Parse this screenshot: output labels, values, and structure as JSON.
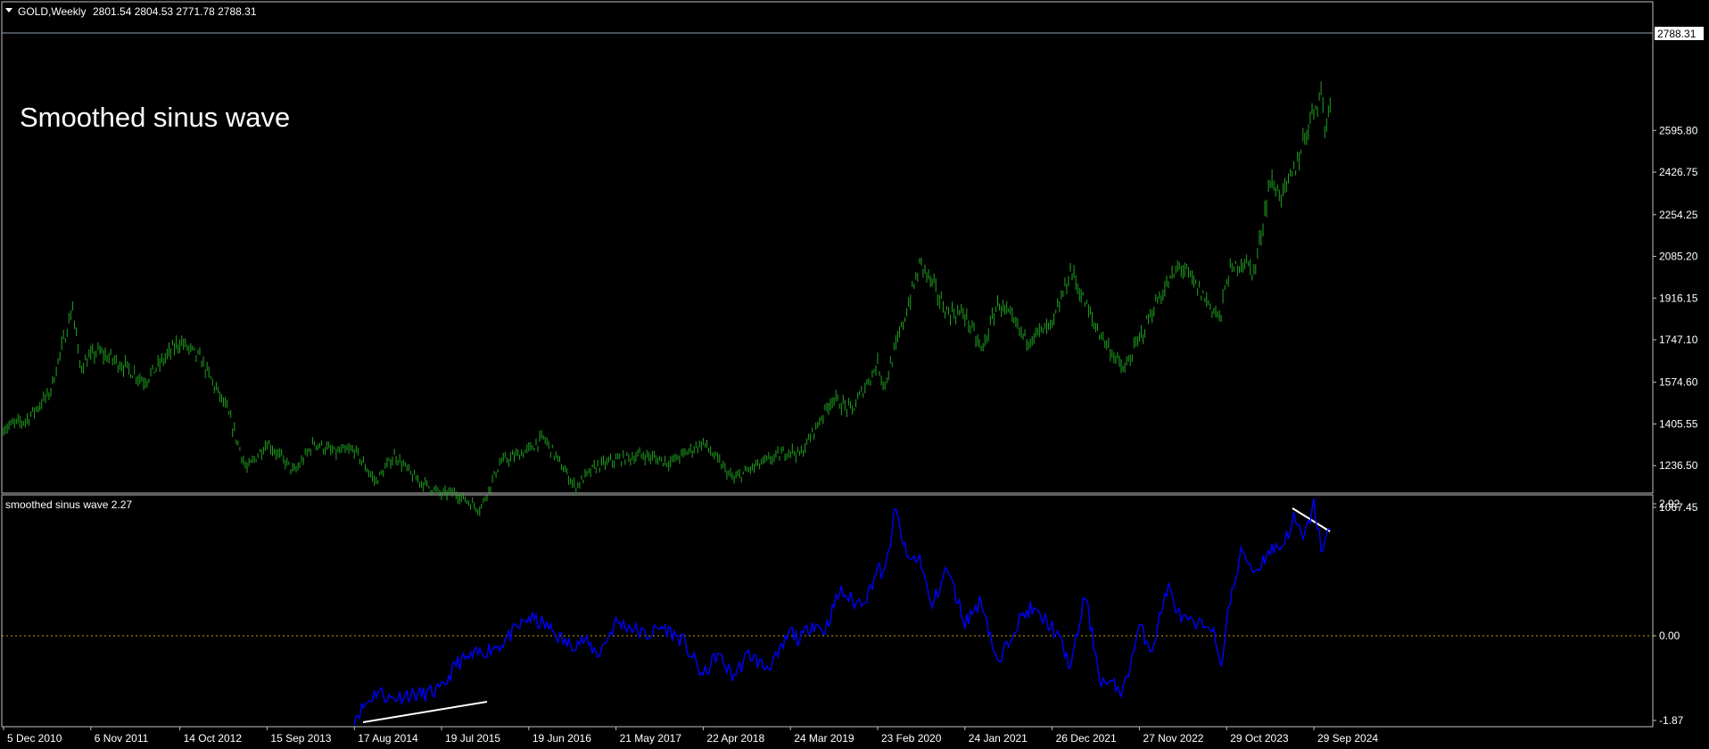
{
  "header": {
    "symbol": "GOLD,Weekly",
    "ohlc": "2801.54 2804.53 2771.78 2788.31",
    "dropdown_icon": "triangle-down-icon"
  },
  "main": {
    "overlay_label": "Smoothed sinus wave",
    "price_marker": "2788.31"
  },
  "indicator": {
    "label": "smoothed sinus wave 2.27"
  },
  "colors": {
    "background": "#000000",
    "candles": "#1fa31f",
    "indicator_line": "#0000ff",
    "trend_lines": "#ffffff",
    "zero_line": "#c8a000",
    "pane_border": "#c0c0c0",
    "current_price_line": "#8fa0b0"
  },
  "chart_data": [
    {
      "type": "bar",
      "title": "GOLD,Weekly",
      "y_ticks": [
        "2595.80",
        "2426.75",
        "2254.25",
        "2085.20",
        "1916.15",
        "1747.10",
        "1574.60",
        "1405.55",
        "1236.50",
        "1067.45"
      ],
      "ylim": [
        1000,
        2800
      ],
      "current_value": 2788.31,
      "x_ticks": [
        "5 Dec 2010",
        "6 Nov 2011",
        "14 Oct 2012",
        "15 Sep 2013",
        "17 Aug 2014",
        "19 Jul 2015",
        "19 Jun 2016",
        "21 May 2017",
        "22 Apr 2018",
        "24 Mar 2019",
        "23 Feb 2020",
        "24 Jan 2021",
        "26 Dec 2021",
        "27 Nov 2022",
        "29 Oct 2023",
        "29 Sep 2024"
      ],
      "series": [
        {
          "name": "GOLD,Weekly",
          "x": [
            "2010-12-05",
            "2011-03-01",
            "2011-06-01",
            "2011-08-28",
            "2011-09-25",
            "2011-12-01",
            "2012-03-01",
            "2012-06-01",
            "2012-10-14",
            "2013-01-01",
            "2013-04-15",
            "2013-06-28",
            "2013-09-15",
            "2013-12-31",
            "2014-03-15",
            "2014-06-01",
            "2014-08-17",
            "2014-11-07",
            "2015-01-20",
            "2015-04-01",
            "2015-07-19",
            "2015-09-01",
            "2015-12-15",
            "2016-03-01",
            "2016-06-19",
            "2016-08-15",
            "2016-12-15",
            "2017-03-01",
            "2017-05-21",
            "2017-09-01",
            "2017-12-15",
            "2018-04-22",
            "2018-08-16",
            "2018-11-01",
            "2019-03-24",
            "2019-05-01",
            "2019-09-01",
            "2019-11-15",
            "2020-02-23",
            "2020-03-20",
            "2020-08-07",
            "2020-11-15",
            "2021-01-24",
            "2021-03-30",
            "2021-06-01",
            "2021-09-15",
            "2021-12-26",
            "2022-03-08",
            "2022-06-01",
            "2022-09-28",
            "2022-11-27",
            "2023-02-01",
            "2023-05-04",
            "2023-10-06",
            "2023-10-29",
            "2023-12-28",
            "2024-02-14",
            "2024-04-12",
            "2024-06-01",
            "2024-07-15",
            "2024-09-29",
            "2024-10-30",
            "2024-11-14",
            "2024-12-06"
          ],
          "values": [
            1390,
            1420,
            1530,
            1880,
            1640,
            1700,
            1650,
            1580,
            1740,
            1670,
            1460,
            1220,
            1330,
            1210,
            1330,
            1290,
            1300,
            1170,
            1280,
            1190,
            1120,
            1130,
            1060,
            1250,
            1300,
            1350,
            1150,
            1230,
            1260,
            1280,
            1250,
            1330,
            1180,
            1230,
            1300,
            1280,
            1510,
            1460,
            1650,
            1560,
            2060,
            1860,
            1850,
            1700,
            1900,
            1750,
            1800,
            2030,
            1820,
            1620,
            1750,
            1900,
            2050,
            1830,
            2000,
            2070,
            2020,
            2390,
            2330,
            2430,
            2690,
            2750,
            2580,
            2788
          ]
        }
      ]
    },
    {
      "type": "line",
      "title": "smoothed sinus wave 2.27",
      "y_ticks": [
        "2.92",
        "0.00",
        "-1.87"
      ],
      "ylim": [
        -1.87,
        2.92
      ],
      "series": [
        {
          "name": "smoothed sinus wave",
          "x": [
            "2014-08-17",
            "2014-10-01",
            "2014-11-15",
            "2015-01-01",
            "2015-03-01",
            "2015-05-01",
            "2015-07-19",
            "2015-09-15",
            "2015-11-01",
            "2016-01-15",
            "2016-03-01",
            "2016-06-19",
            "2016-09-01",
            "2016-11-15",
            "2017-01-15",
            "2017-03-15",
            "2017-05-21",
            "2017-07-15",
            "2017-09-15",
            "2017-11-15",
            "2018-02-01",
            "2018-04-22",
            "2018-06-15",
            "2018-08-15",
            "2018-10-15",
            "2018-12-15",
            "2019-02-01",
            "2019-03-24",
            "2019-05-01",
            "2019-06-15",
            "2019-08-01",
            "2019-10-01",
            "2019-12-01",
            "2020-01-15",
            "2020-02-23",
            "2020-03-20",
            "2020-05-01",
            "2020-06-15",
            "2020-08-07",
            "2020-09-15",
            "2020-11-15",
            "2021-01-24",
            "2021-03-30",
            "2021-06-01",
            "2021-08-01",
            "2021-10-01",
            "2021-12-26",
            "2022-02-01",
            "2022-03-08",
            "2022-05-01",
            "2022-07-01",
            "2022-09-28",
            "2022-11-27",
            "2023-01-15",
            "2023-03-15",
            "2023-05-04",
            "2023-07-01",
            "2023-09-01",
            "2023-10-06",
            "2023-10-29",
            "2023-12-28",
            "2024-02-14",
            "2024-04-12",
            "2024-06-01",
            "2024-07-15",
            "2024-08-20",
            "2024-09-29",
            "2024-10-30",
            "2024-11-14",
            "2024-12-06"
          ],
          "values": [
            -1.8,
            -1.5,
            -1.2,
            -1.4,
            -1.3,
            -1.3,
            -1.2,
            -0.6,
            -0.5,
            -0.3,
            -0.2,
            0.4,
            0.2,
            -0.2,
            -0.1,
            -0.4,
            0.3,
            0.2,
            0.0,
            0.2,
            -0.1,
            -0.9,
            -0.4,
            -0.9,
            -0.4,
            -0.7,
            -0.5,
            0.1,
            -0.1,
            0.3,
            0.1,
            1.0,
            0.7,
            0.9,
            1.5,
            1.3,
            2.8,
            1.7,
            1.7,
            0.6,
            1.5,
            0.3,
            0.8,
            -0.7,
            0.2,
            0.6,
            0.2,
            -0.2,
            -0.7,
            0.9,
            -1.0,
            -1.2,
            0.2,
            -0.3,
            1.1,
            0.4,
            0.2,
            0.3,
            -0.8,
            0.4,
            1.9,
            1.4,
            1.9,
            2.0,
            2.6,
            2.1,
            2.9,
            1.9,
            2.1,
            2.5
          ]
        }
      ]
    }
  ]
}
